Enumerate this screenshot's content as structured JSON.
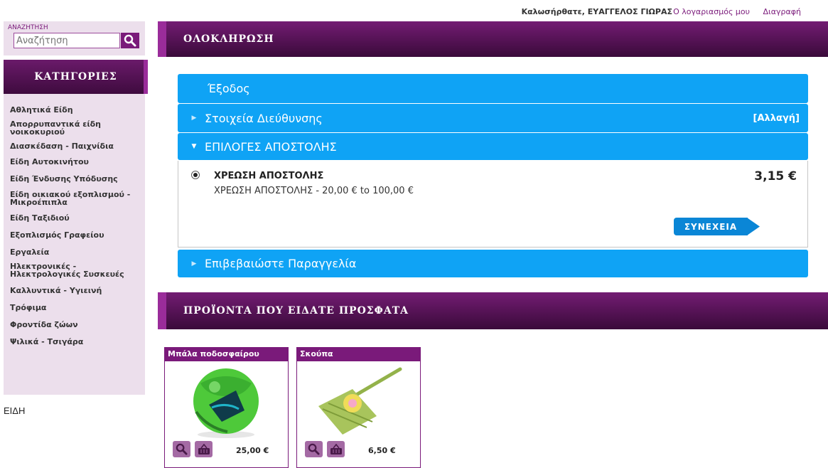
{
  "topbar": {
    "greeting": "Καλωσήρθατε, ΕΥΑΓΓΕΛΟΣ ΓΙΩΡΑΣ",
    "account_link": "Ο λογαριασμός μου",
    "logout_link": "Διαγραφή"
  },
  "search": {
    "label": "ΑΝΑΖΗΤΗΣΗ",
    "placeholder": "Αναζήτηση",
    "icon": "search-icon"
  },
  "categories": {
    "title": "ΚΑΤΗΓΟΡΙΕΣ",
    "items": [
      "Αθλητικά Είδη",
      "Απορρυπαντικά είδη νοικοκυριού",
      "Διασκέδαση - Παιχνίδια",
      "Είδη Αυτοκινήτου",
      "Είδη Ένδυσης Υπόδυσης",
      "Είδη οικιακού εξοπλισμού - Μικροέπιπλα",
      "Είδη Ταξιδιού",
      "Εξοπλισμός Γραφείου",
      "Εργαλεία",
      "Ηλεκτρονικές - Ηλεκτρολογικές Συσκευές",
      "Καλλυντικά - Υγιεινή",
      "Τρόφιμα",
      "Φροντίδα ζώων",
      "Ψιλικά - Τσιγάρα"
    ],
    "footer_label": "ΕΙΔΗ"
  },
  "checkout": {
    "title": "ΟΛΟΚΛΗΡΩΣΗ",
    "steps": {
      "logout": "Έξοδος",
      "address": "Στοιχεία Διεύθυνσης",
      "address_change": "[Αλλαγή]",
      "shipping": "ΕΠΙΛΟΓΕΣ ΑΠΟΣΤΟΛΗΣ",
      "confirm": "Επιβεβαιώστε Παραγγελία"
    },
    "shipping_option": {
      "name": "ΧΡΕΩΣΗ ΑΠΟΣΤΟΛΗΣ",
      "description": "ΧΡΕΩΣΗ ΑΠΟΣΤΟΛΗΣ - 20,00 € to 100,00 €",
      "price": "3,15 €",
      "selected": true
    },
    "continue_label": "ΣΥΝΕΧΕΙΑ"
  },
  "recent": {
    "title": "ΠΡΟΪΟΝΤΑ ΠΟΥ ΕΙΔΑΤΕ ΠΡΟΣΦΑΤΑ",
    "products": [
      {
        "name": "Μπάλα ποδοσφαίρου",
        "price": "25,00 €"
      },
      {
        "name": "Σκούπα",
        "price": "6,50 €"
      }
    ]
  },
  "colors": {
    "brand_purple": "#7a1a7a",
    "accordion_blue": "#0fa3f5",
    "sidebar_bg": "#ecdfec"
  }
}
